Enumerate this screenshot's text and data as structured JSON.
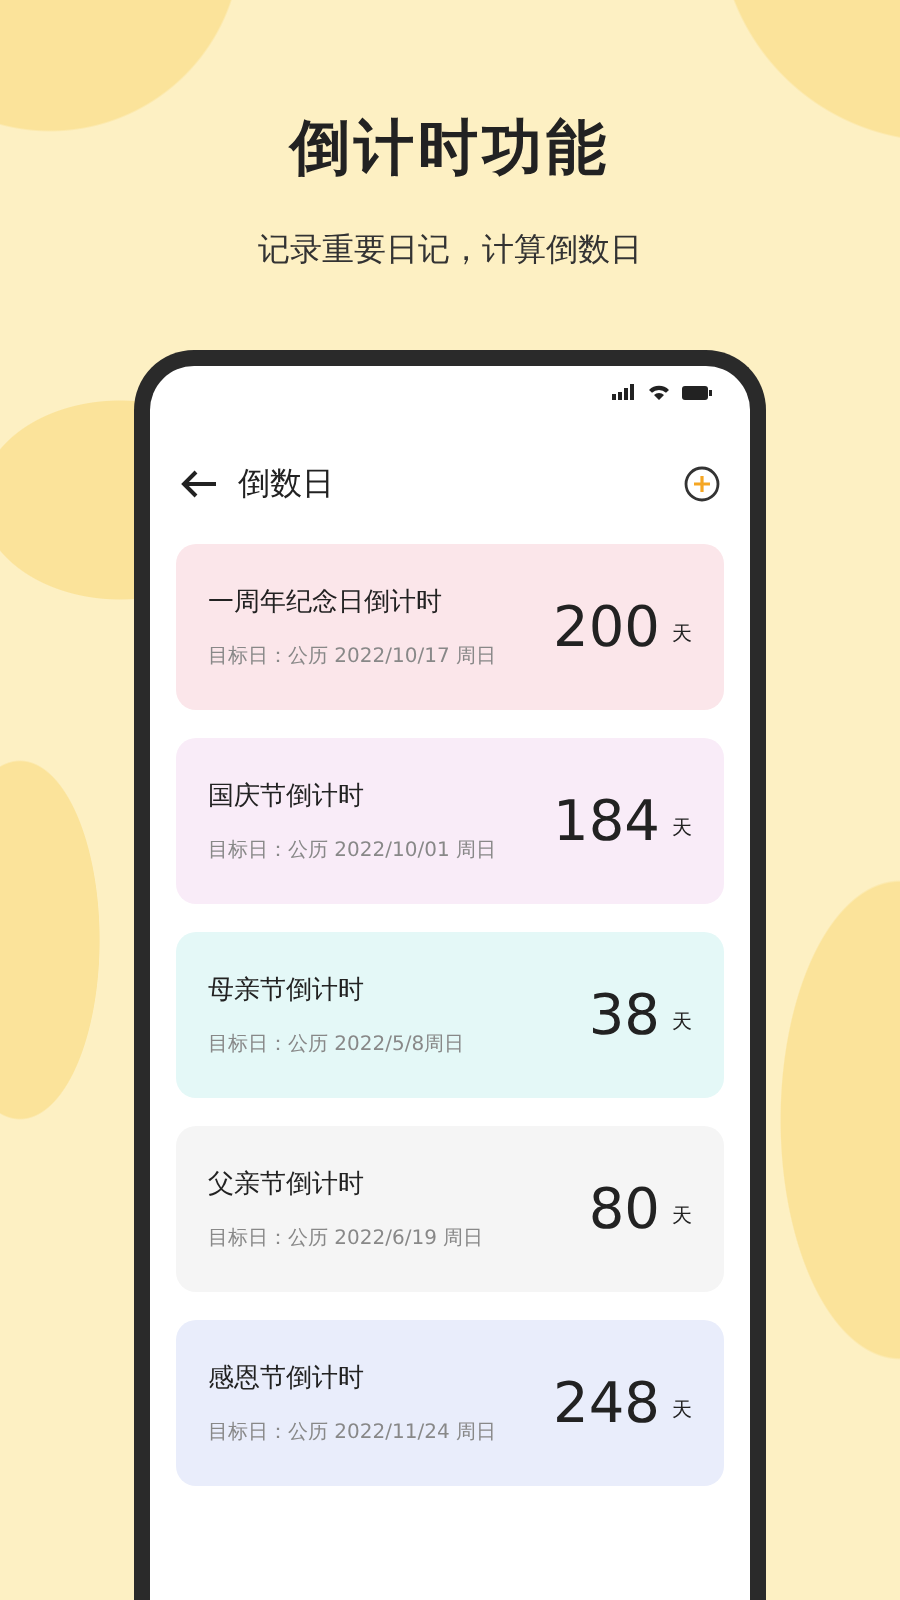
{
  "headline": "倒计时功能",
  "subheadline": "记录重要日记，计算倒数日",
  "app_bar": {
    "title": "倒数日"
  },
  "countdowns": [
    {
      "name": "一周年纪念日倒计时",
      "target": "目标日：公历 2022/10/17 周日",
      "days": "200",
      "unit": "天",
      "color": "#fbe6ea"
    },
    {
      "name": "国庆节倒计时",
      "target": "目标日：公历 2022/10/01 周日",
      "days": "184",
      "unit": "天",
      "color": "#f9ecf8"
    },
    {
      "name": "母亲节倒计时",
      "target": "目标日：公历 2022/5/8周日",
      "days": "38",
      "unit": "天",
      "color": "#e4f8f7"
    },
    {
      "name": "父亲节倒计时",
      "target": "目标日：公历 2022/6/19 周日",
      "days": "80",
      "unit": "天",
      "color": "#f5f5f5"
    },
    {
      "name": "感恩节倒计时",
      "target": "目标日：公历 2022/11/24 周日",
      "days": "248",
      "unit": "天",
      "color": "#e9edfb"
    }
  ]
}
